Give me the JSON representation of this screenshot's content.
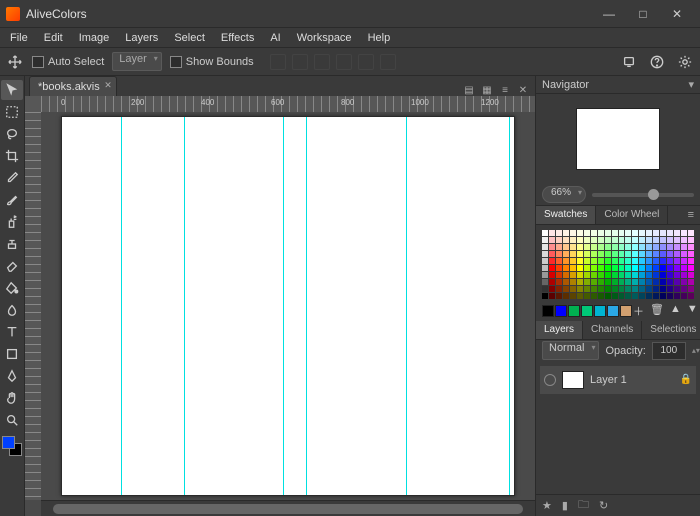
{
  "app_title": "AliveColors",
  "menu": [
    "File",
    "Edit",
    "Image",
    "Layers",
    "Select",
    "Effects",
    "AI",
    "Workspace",
    "Help"
  ],
  "options": {
    "auto_select": "Auto Select",
    "layer_dropdown": "Layer",
    "show_bounds": "Show Bounds"
  },
  "document": {
    "tab_title": "*books.akvis"
  },
  "ruler_labels": [
    "0",
    "200",
    "400",
    "600",
    "800",
    "1000",
    "1200"
  ],
  "guides_pct": [
    13,
    27,
    49,
    54,
    76,
    99
  ],
  "navigator": {
    "title": "Navigator",
    "zoom": "66%"
  },
  "swatches": {
    "tabs": [
      "Swatches",
      "Color Wheel"
    ],
    "bottom": [
      "#000000",
      "#0000ff",
      "#00b050",
      "#00c878",
      "#00b4d2",
      "#2aa8e6",
      "#d2a070"
    ],
    "ramp": {
      "grays": [
        "#ffffff",
        "#f2f2f2",
        "#e6e6e6",
        "#d9d9d9",
        "#cccccc",
        "#bfbfbf",
        "#999999",
        "#666666",
        "#333333",
        "#000000"
      ],
      "hues": [
        "#ff0000",
        "#ff4000",
        "#ff8000",
        "#ffbf00",
        "#ffff00",
        "#bfff00",
        "#80ff00",
        "#40ff00",
        "#00ff00",
        "#00ff40",
        "#00ff80",
        "#00ffbf",
        "#00ffff",
        "#00bfff",
        "#0080ff",
        "#0040ff",
        "#0000ff",
        "#4000ff",
        "#8000ff",
        "#bf00ff",
        "#ff00ff"
      ],
      "lightness": [
        0.95,
        0.88,
        0.78,
        0.68,
        0.58,
        0.5,
        0.42,
        0.34,
        0.26,
        0.18
      ]
    }
  },
  "layers": {
    "tabs": [
      "Layers",
      "Channels",
      "Selections"
    ],
    "blend": "Normal",
    "opacity_label": "Opacity:",
    "opacity_value": "100",
    "items": [
      {
        "name": "Layer 1"
      }
    ]
  }
}
